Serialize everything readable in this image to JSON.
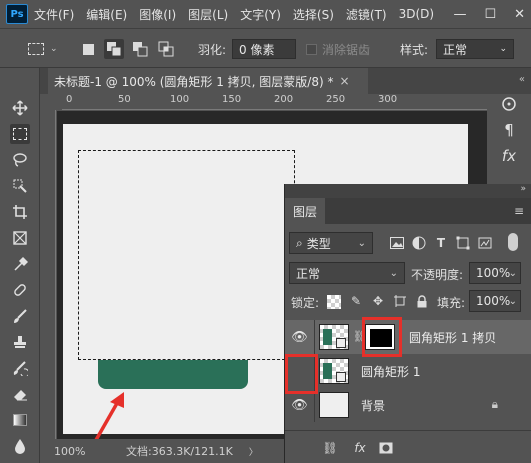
{
  "app": {
    "logo": "Ps"
  },
  "menu": [
    "文件(F)",
    "编辑(E)",
    "图像(I)",
    "图层(L)",
    "文字(Y)",
    "选择(S)",
    "滤镜(T)",
    "3D(D)"
  ],
  "window_controls": {
    "minimize": "—",
    "maximize": "☐",
    "close": "✕"
  },
  "options": {
    "feather_label": "羽化:",
    "feather_value": "0 像素",
    "antialias_label": "消除锯齿",
    "style_label": "样式:",
    "style_value": "正常"
  },
  "document": {
    "tab_title": "未标题-1 @ 100% (圆角矩形 1 拷贝, 图层蒙版/8) *",
    "tab_close": "×"
  },
  "ruler": {
    "top_ticks": [
      "0",
      "50",
      "100",
      "150",
      "200",
      "250",
      "300"
    ]
  },
  "status": {
    "zoom": "100%",
    "doc_size": "文档:363.3K/121.1K",
    "arrow": "〉"
  },
  "layers_panel": {
    "title": "图层",
    "filter_kind": "类型",
    "blend_mode": "正常",
    "opacity_label": "不透明度:",
    "opacity_value": "100%",
    "lock_label": "锁定:",
    "fill_label": "填充:",
    "fill_value": "100%",
    "layers": [
      {
        "name": "圆角矩形 1 拷贝",
        "visible": true,
        "selected": true
      },
      {
        "name": "圆角矩形 1",
        "visible": false,
        "selected": false
      },
      {
        "name": "背景",
        "visible": true,
        "selected": false
      }
    ]
  },
  "colors": {
    "shape_green": "#2a7058",
    "annotation_red": "#e5302a",
    "panel_bg": "#535353"
  }
}
